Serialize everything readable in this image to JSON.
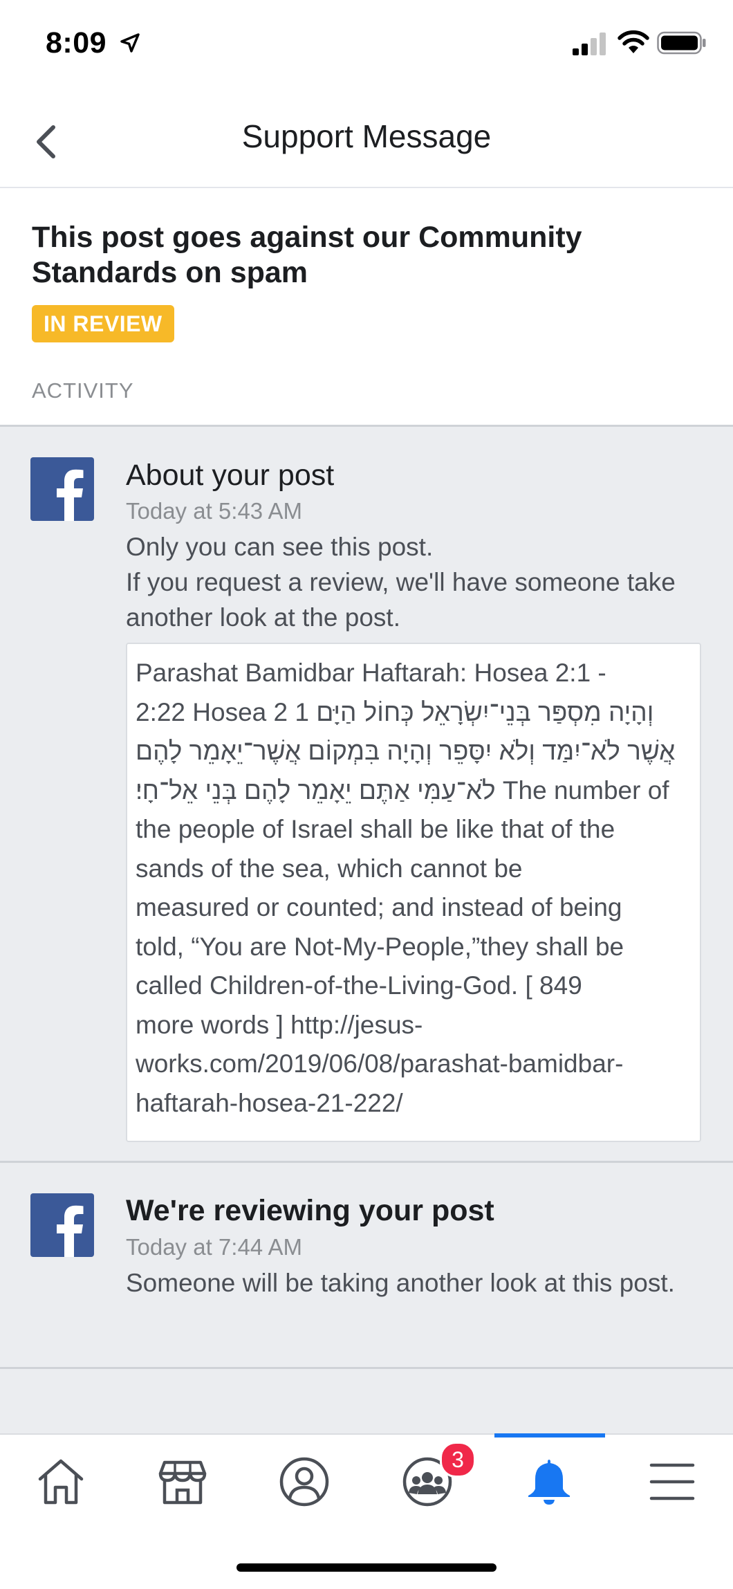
{
  "status_bar": {
    "time": "8:09"
  },
  "nav": {
    "title": "Support Message"
  },
  "header": {
    "title": "This post goes against our Community Standards on spam",
    "badge": "IN REVIEW",
    "activity_label": "ACTIVITY"
  },
  "activity": [
    {
      "title": "About your post",
      "time": "Today at 5:43 AM",
      "body_lines": [
        "Only you can see this post.",
        "If you request a review, we'll have someone take another look at the post."
      ],
      "post": {
        "lines": [
          "Parashat Bamidbar Haftarah: Hosea 2:1 -",
          "2:22 Hosea 2 1 וְהָיָה מִסְפַּר בְּנֵי־יִשְׂרָאֵל כְּחוֹל הַיָּם",
          "אֲשֶׁר לֹא־יִמַּד וְלֹא יִסָּפֵר וְהָיָה בִּמְקוֹם אֲשֶׁר־יֵאָמֵר לָהֶם",
          "לֹא־עַמִּי אַתֶּם יֵאָמֵר לָהֶם בְּנֵי אֵל־חָי׃ The number of",
          "the people of Israel shall be like that of the",
          "sands of the sea, which cannot be",
          "measured or counted; and instead of being",
          "told, “You are Not-My-People,”they shall be",
          "called Children-of-the-Living-God. [ 849",
          "more words ] http://jesus-",
          "works.com/2019/06/08/parashat-bamidbar-",
          "haftarah-hosea-21-222/"
        ]
      }
    },
    {
      "title": "We're reviewing your post",
      "time": "Today at 7:44 AM",
      "body": "Someone will be taking another look at this post."
    }
  ],
  "tab_bar": {
    "tabs": [
      "home-icon",
      "marketplace-icon",
      "profile-icon",
      "groups-icon",
      "notifications-icon",
      "menu-icon"
    ],
    "groups_badge": "3",
    "active_tab": "notifications-icon",
    "active_color": "#1877f2"
  },
  "colors": {
    "badge": "#f7b928",
    "facebook_blue": "#3b5998",
    "feed_bg": "#ebedf0",
    "notification_badge": "#f02849"
  }
}
